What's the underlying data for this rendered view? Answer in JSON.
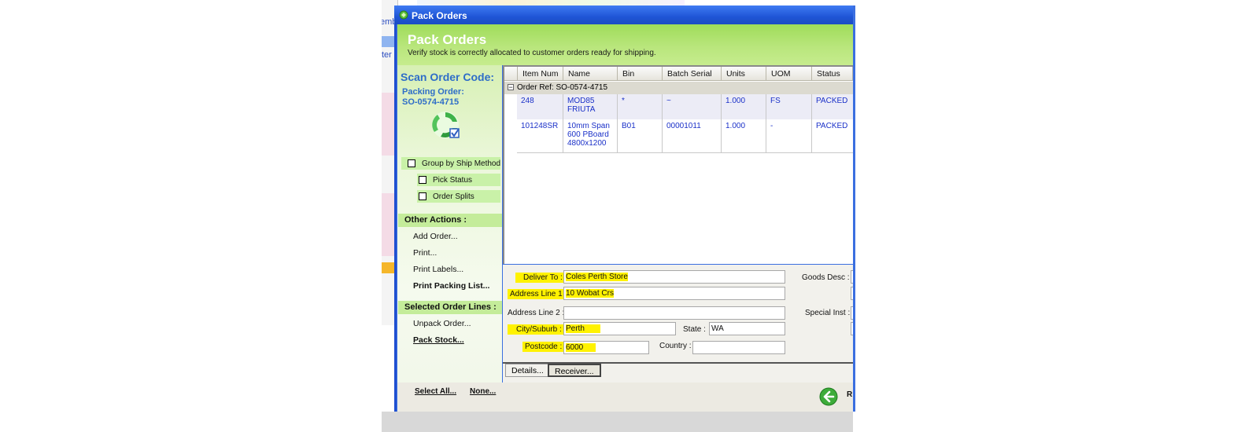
{
  "background_app": {
    "fragment_1": "emb",
    "fragment_2": "ter"
  },
  "window": {
    "title": "Pack Orders"
  },
  "header": {
    "title": "Pack Orders",
    "subtitle": "Verify stock is correctly allocated to customer orders ready for shipping."
  },
  "left_pane": {
    "scan_title": "Scan Order Code:",
    "packing_order_label": "Packing Order:",
    "packing_order_code": "SO-0574-4715",
    "checkboxes": [
      {
        "label": "Group by Ship Method",
        "checked": false
      },
      {
        "label": "Pick Status",
        "checked": false
      },
      {
        "label": "Order Splits",
        "checked": false
      }
    ],
    "other_actions_title": "Other Actions :",
    "other_actions": [
      "Add Order...",
      "Print...",
      "Print Labels...",
      "Print Packing List..."
    ],
    "selected_lines_title": "Selected Order Lines :",
    "selected_actions": [
      "Unpack Order...",
      "Pack Stock..."
    ]
  },
  "grid": {
    "columns": [
      "Item Num",
      "Name",
      "Bin",
      "Batch Serial",
      "Units",
      "UOM",
      "Status"
    ],
    "group_label": "Order Ref: SO-0574-4715",
    "rows": [
      {
        "item_num": "248",
        "name": "MOD85 FRIUTA",
        "bin": "*",
        "batch_serial": "~",
        "units": "1.000",
        "uom": "FS",
        "status": "PACKED"
      },
      {
        "item_num": "101248SR",
        "name": "10mm Span 600 PBoard 4800x1200",
        "bin": "B01",
        "batch_serial": "00001011",
        "units": "1.000",
        "uom": "-",
        "status": "PACKED"
      }
    ]
  },
  "receiver": {
    "deliver_to_label": "Deliver To :",
    "deliver_to": "Coles Perth Store",
    "address1_label": "Address Line 1 :",
    "address1": "10 Wobat Crs",
    "address2_label": "Address Line 2 :",
    "address2": "",
    "city_label": "City/Suburb :",
    "city": "Perth",
    "state_label": "State :",
    "state": "WA",
    "postcode_label": "Postcode :",
    "postcode": "6000",
    "country_label": "Country :",
    "country": "",
    "goods_desc_label": "Goods Desc :",
    "special_inst_label": "Special Inst :"
  },
  "tabs": [
    "Details...",
    "Receiver..."
  ],
  "footer": {
    "select_all": "Select All...",
    "none": "None...",
    "back_label": "R"
  },
  "colors": {
    "title_blue": "#1f55d6",
    "header_green": "#a8df66",
    "highlight_yellow": "#fff200",
    "data_blue": "#1a30c8"
  }
}
